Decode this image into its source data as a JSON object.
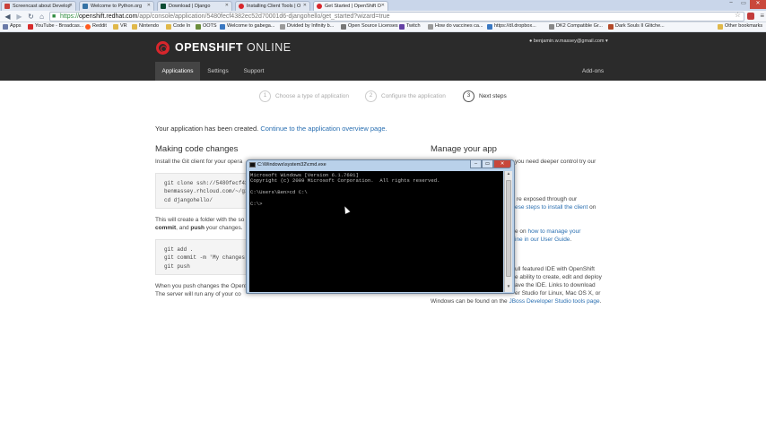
{
  "browser": {
    "tabs": [
      {
        "label": "Screencast about Develop",
        "color": "#c9403a"
      },
      {
        "label": "Welcome to Python.org",
        "color": "#3572a5"
      },
      {
        "label": "Download | Django",
        "color": "#0c4b33"
      },
      {
        "label": "Installing Client Tools | O",
        "color": "#d7262c"
      },
      {
        "label": "Get Started | OpenShift O",
        "color": "#d7262c"
      }
    ],
    "url": {
      "scheme": "https://",
      "host": "openshift.redhat.com",
      "path": "/app/console/application/5480fecf4382ec52d70001d6-djangohello/get_started?wizard=true"
    },
    "bookmarks_bar": [
      {
        "label": "Apps",
        "color": "#6a7aa8"
      },
      {
        "label": "YouTube - Broadcas...",
        "color": "#d62b2b"
      },
      {
        "label": "Reddit",
        "color": "#ff5a1f"
      },
      {
        "label": "VR",
        "color": "#9a9a9a"
      },
      {
        "label": "Nintendo",
        "color": "#d62b2b"
      },
      {
        "label": "Code In",
        "color": "#555555"
      },
      {
        "label": "OOTS",
        "color": "#6b8e3d"
      },
      {
        "label": "Welcome to gabega...",
        "color": "#3a78c2"
      },
      {
        "label": "Divided by Infinity b...",
        "color": "#9a9a9a"
      },
      {
        "label": "Open Source Licenses",
        "color": "#777777"
      },
      {
        "label": "Twitch",
        "color": "#6441a5"
      },
      {
        "label": "How do vaccines ca...",
        "color": "#9a9a9a"
      },
      {
        "label": "https://dl.dropbox...",
        "color": "#3a78c2"
      },
      {
        "label": "DK2 Compatible Gr...",
        "color": "#888888"
      },
      {
        "label": "Dark Souls II Glitche...",
        "color": "#b34a2a"
      },
      {
        "label": "Other bookmarks",
        "color": "#e0b84a"
      }
    ]
  },
  "site": {
    "logo_bold": "OPENSHIFT",
    "logo_light": " ONLINE",
    "user_email": "benjamin.w.massey@gmail.com ▾",
    "nav": [
      "Applications",
      "Settings",
      "Support"
    ],
    "nav_right": "Add-ons",
    "steps": [
      {
        "num": "1",
        "label": "Choose a type of application"
      },
      {
        "num": "2",
        "label": "Configure the application"
      },
      {
        "num": "3",
        "label": "Next steps"
      }
    ],
    "created_text": "Your application has been created. ",
    "created_link": "Continue to the application overview page.",
    "left_heading": "Making code changes",
    "install_text": "Install the Git client for your opera",
    "code_clone": "git clone ssh://5480fecf43\nbenmassey.rhcloud.com/~/gi\ncd djangohello/",
    "folder_text": "This will create a folder with the so",
    "commit_pre": "commit",
    "commit_mid": ", and ",
    "commit_push": "push",
    "commit_post": " your changes.",
    "code_push": "git add .\ngit commit -m 'My changes'\ngit push",
    "push_text_1": "When you push changes the OpenS",
    "push_text_2": "The server will run any of your co",
    "right_heading": "Manage your app",
    "right_p1": "you need deeper control try our",
    "right_p2a": "re exposed through our",
    "right_p2b_link": "ese steps to install the client",
    "right_p2b_post": " on",
    "right_p3_pre": "e on ",
    "right_p3_link": "how to manage your",
    "right_p3b_link": "ine in our User Guide",
    "right_p3b_post": ".",
    "right_p4a": "ull featured IDE with OpenShift",
    "right_p4b": "e ability to create, edit and deploy",
    "right_p4c": "ave the IDE. Links to download",
    "right_p4d": "er Studio for Linux, Mac OS X, or",
    "right_p4e_pre": "Windows can be found on the ",
    "right_p4e_link": "JBoss Developer Studio tools page",
    "right_p4e_post": "."
  },
  "cmd": {
    "title": "C:\\Windows\\system32\\cmd.exe",
    "screen": "Microsoft Windows [Version 6.1.7601]\nCopyright (c) 2009 Microsoft Corporation.  All rights reserved.\n\nC:\\Users\\Ben>cd C:\\\n\nC:\\>"
  }
}
